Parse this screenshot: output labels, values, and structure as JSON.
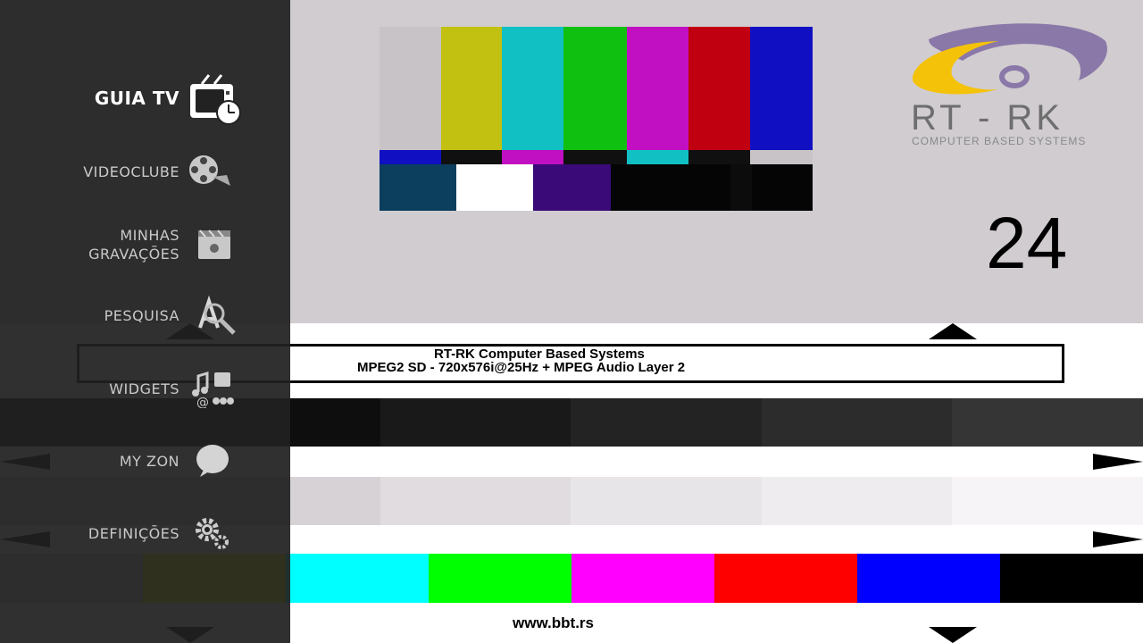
{
  "menu": {
    "items": [
      {
        "label": "GUIA TV",
        "icon": "tv-guide-icon",
        "active": true
      },
      {
        "label": "VIDEOCLUBE",
        "icon": "film-reel-icon"
      },
      {
        "label": "MINHAS",
        "label2": "GRAVAÇÕES",
        "icon": "recordings-icon"
      },
      {
        "label": "PESQUISA",
        "icon": "search-icon"
      },
      {
        "label": "WIDGETS",
        "icon": "widgets-icon"
      },
      {
        "label": "MY ZON",
        "icon": "speech-bubble-icon"
      },
      {
        "label": "DEFINIÇÕES",
        "icon": "gear-icon"
      }
    ]
  },
  "test_card": {
    "logo_text": "RT - RK",
    "logo_subtitle": "COMPUTER BASED SYSTEMS",
    "channel_number": "24",
    "info_line1": "RT-RK Computer Based Systems",
    "info_line2": "MPEG2 SD - 720x576i@25Hz + MPEG Audio Layer 2",
    "website": "www.bbt.rs",
    "colors": {
      "top_bars": [
        "#c7c3c7",
        "#c2c010",
        "#10c0c2",
        "#10c010",
        "#c010c2",
        "#c00010",
        "#1010c2"
      ],
      "bottom_bars": [
        "#00ffff",
        "#00ff00",
        "#ff00ff",
        "#ff0000",
        "#0000ff",
        "#000000"
      ],
      "logo_yellow": "#f5c20a",
      "logo_purple": "#8a78a8"
    }
  }
}
